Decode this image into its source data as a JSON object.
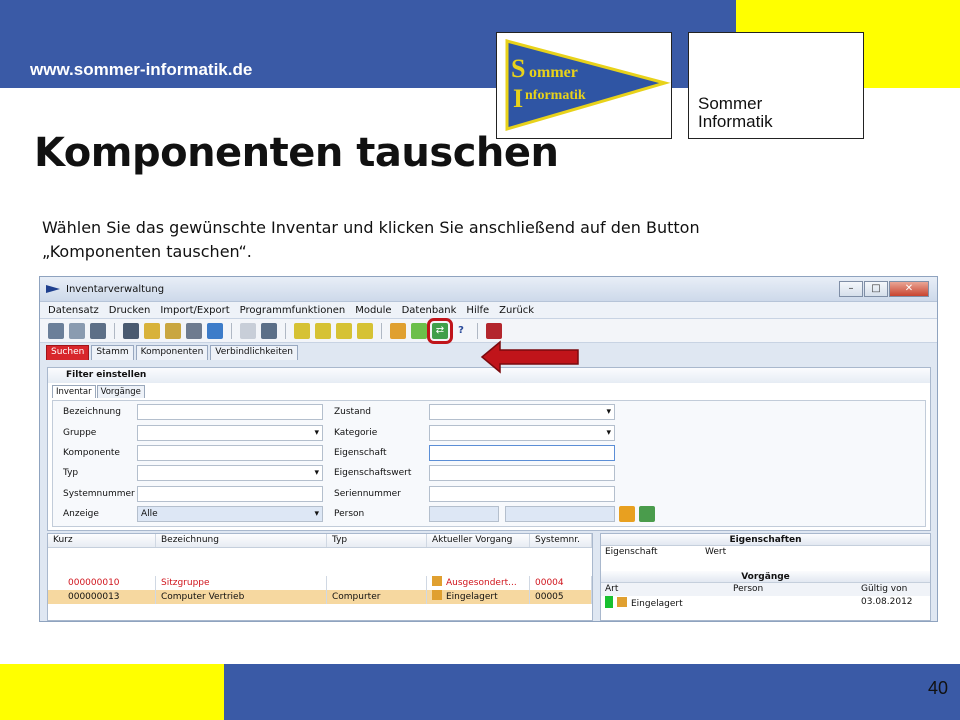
{
  "slide": {
    "url": "www.sommer-informatik.de",
    "title": "Komponenten tauschen",
    "description": "Wählen Sie das gewünschte Inventar und klicken Sie anschließend auf den Button „Komponenten tauschen“.",
    "page_number": "40",
    "logo_pennant_line1": "ommer",
    "logo_pennant_line2": "nformatik",
    "logo_pennant_initial1": "S",
    "logo_pennant_initial2": "I",
    "logo_text": "Sommer\nInformatik",
    "colors": {
      "blue": "#3a5aa6",
      "yellow": "#ffff00",
      "highlight": "#c0141a"
    }
  },
  "app": {
    "title": "Inventarverwaltung",
    "menu": [
      "Datensatz",
      "Drucken",
      "Import/Export",
      "Programmfunktionen",
      "Module",
      "Datenbank",
      "Hilfe",
      "Zurück"
    ],
    "tabs": [
      "Suchen",
      "Stamm",
      "Komponenten",
      "Verbindlichkeiten"
    ],
    "filter_title": "Filter einstellen",
    "subtabs": [
      "Inventar",
      "Vorgänge"
    ],
    "fields_left": [
      {
        "label": "Bezeichnung",
        "value": ""
      },
      {
        "label": "Gruppe",
        "value": ""
      },
      {
        "label": "Komponente",
        "value": ""
      },
      {
        "label": "Typ",
        "value": ""
      },
      {
        "label": "Systemnummer",
        "value": ""
      },
      {
        "label": "Anzeige",
        "value": "Alle"
      }
    ],
    "fields_right": [
      {
        "label": "Zustand",
        "value": ""
      },
      {
        "label": "Kategorie",
        "value": ""
      },
      {
        "label": "Eigenschaft",
        "value": ""
      },
      {
        "label": "Eigenschaftswert",
        "value": ""
      },
      {
        "label": "Seriennummer",
        "value": ""
      },
      {
        "label": "Person",
        "value": ""
      }
    ],
    "grid_columns": [
      "Kurz",
      "Bezeichnung",
      "Typ",
      "Aktueller Vorgang",
      "Systemnr."
    ],
    "grid_rows": [
      {
        "kurz": "000000010",
        "bez": "Sitzgruppe",
        "typ": "",
        "vorgang": "Ausgesondert...",
        "sys": "00004"
      },
      {
        "kurz": "000000013",
        "bez": "Computer Vertrieb",
        "typ": "Compurter",
        "vorgang": "Eingelagert",
        "sys": "00005"
      }
    ],
    "eigenschaften": {
      "title": "Eigenschaften",
      "col1": "Eigenschaft",
      "col2": "Wert"
    },
    "vorgaenge": {
      "title": "Vorgänge",
      "cols": [
        "Art",
        "Person",
        "Gültig von"
      ],
      "row": {
        "art": "Eingelagert",
        "person": "",
        "datum": "03.08.2012"
      }
    }
  }
}
